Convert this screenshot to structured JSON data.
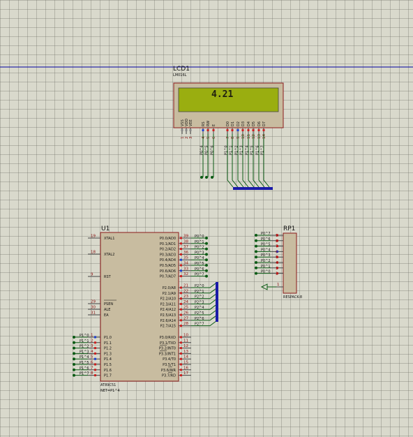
{
  "lcd": {
    "ref": "LCD1",
    "model": "LM016L",
    "display": "4.21",
    "pins": [
      "VSS",
      "VDD",
      "VEE",
      "RS",
      "RW",
      "E",
      "D0",
      "D1",
      "D2",
      "D3",
      "D4",
      "D5",
      "D6",
      "D7"
    ],
    "pin_numbers": [
      "1",
      "2",
      "3",
      "4",
      "5",
      "6",
      "7",
      "8",
      "9",
      "10",
      "11",
      "12",
      "13",
      "14"
    ],
    "ctrl_nets": [
      "P0^4",
      "P0^5",
      "P0^6"
    ],
    "data_nets": [
      "P1^0",
      "P1^1",
      "P1^2",
      "P1^3",
      "P1^4",
      "P1^5",
      "P1^6",
      "P1^7"
    ]
  },
  "mcu": {
    "ref": "U1",
    "model": "AT89C51",
    "net_note": "NET=P1^4",
    "left_pins": [
      {
        "num": "19",
        "name": "XTAL1"
      },
      {
        "num": "18",
        "name": "XTAL2"
      },
      {
        "num": "9",
        "name": "RST"
      },
      {
        "num": "29",
        "name": "PSEN"
      },
      {
        "num": "30",
        "name": "ALE"
      },
      {
        "num": "31",
        "name": "EA"
      }
    ],
    "p1_pins": [
      {
        "num": "1",
        "name": "P1.0",
        "net": "P1^0"
      },
      {
        "num": "2",
        "name": "P1.1",
        "net": "P1^1"
      },
      {
        "num": "3",
        "name": "P1.2",
        "net": "P1^2"
      },
      {
        "num": "4",
        "name": "P1.3",
        "net": "P1^3"
      },
      {
        "num": "5",
        "name": "P1.4",
        "net": "P1^4"
      },
      {
        "num": "6",
        "name": "P1.5",
        "net": "P1^5"
      },
      {
        "num": "7",
        "name": "P1.6",
        "net": "P1^6"
      },
      {
        "num": "8",
        "name": "P1.7",
        "net": "P1^7"
      }
    ],
    "p0_pins": [
      {
        "num": "39",
        "name": "P0.0/AD0",
        "net": "P0^0"
      },
      {
        "num": "38",
        "name": "P0.1/AD1",
        "net": "P0^1"
      },
      {
        "num": "37",
        "name": "P0.2/AD2",
        "net": "P0^2"
      },
      {
        "num": "36",
        "name": "P0.3/AD3",
        "net": "P0^3"
      },
      {
        "num": "35",
        "name": "P0.4/AD4",
        "net": "P0^4"
      },
      {
        "num": "34",
        "name": "P0.5/AD5",
        "net": "P0^5"
      },
      {
        "num": "33",
        "name": "P0.6/AD6",
        "net": "P0^6"
      },
      {
        "num": "32",
        "name": "P0.7/AD7",
        "net": "P0^7"
      }
    ],
    "p2_pins": [
      {
        "num": "21",
        "name": "P2.0/A8",
        "net": "P2^0"
      },
      {
        "num": "22",
        "name": "P2.1/A9",
        "net": "P2^1"
      },
      {
        "num": "23",
        "name": "P2.2/A10",
        "net": "P2^2"
      },
      {
        "num": "24",
        "name": "P2.3/A11",
        "net": "P2^3"
      },
      {
        "num": "25",
        "name": "P2.4/A12",
        "net": "P2^4"
      },
      {
        "num": "26",
        "name": "P2.5/A13",
        "net": "P2^5"
      },
      {
        "num": "27",
        "name": "P2.6/A14",
        "net": "P2^6"
      },
      {
        "num": "28",
        "name": "P2.7/A15",
        "net": "P2^7"
      }
    ],
    "p3_pins": [
      {
        "num": "10",
        "name": "P3.0/RXD"
      },
      {
        "num": "11",
        "name": "P3.1/TXD"
      },
      {
        "num": "12",
        "name": "P3.2/INT0"
      },
      {
        "num": "13",
        "name": "P3.3/INT1"
      },
      {
        "num": "14",
        "name": "P3.4/T0"
      },
      {
        "num": "15",
        "name": "P3.5/T1"
      },
      {
        "num": "16",
        "name": "P3.6/WR"
      },
      {
        "num": "17",
        "name": "P3.7/RD"
      }
    ]
  },
  "rpack": {
    "ref": "RP1",
    "model": "RESPACK-8",
    "pins": [
      {
        "num": "9",
        "net": "P0^7"
      },
      {
        "num": "8",
        "net": "P0^6"
      },
      {
        "num": "7",
        "net": "P0^5"
      },
      {
        "num": "6",
        "net": "P0^4"
      },
      {
        "num": "5",
        "net": "P0^3"
      },
      {
        "num": "4",
        "net": "P0^2"
      },
      {
        "num": "3",
        "net": "P0^1"
      },
      {
        "num": "2",
        "net": "P0^0"
      }
    ],
    "common_pin": "1"
  },
  "colors": {
    "component_fill": "#c8bca0",
    "component_border": "#8b1a1a",
    "wire": "#0a5a14",
    "bus": "#1a1aa8",
    "lcd_screen": "#9aae10",
    "guide_line": "#0000a0"
  }
}
